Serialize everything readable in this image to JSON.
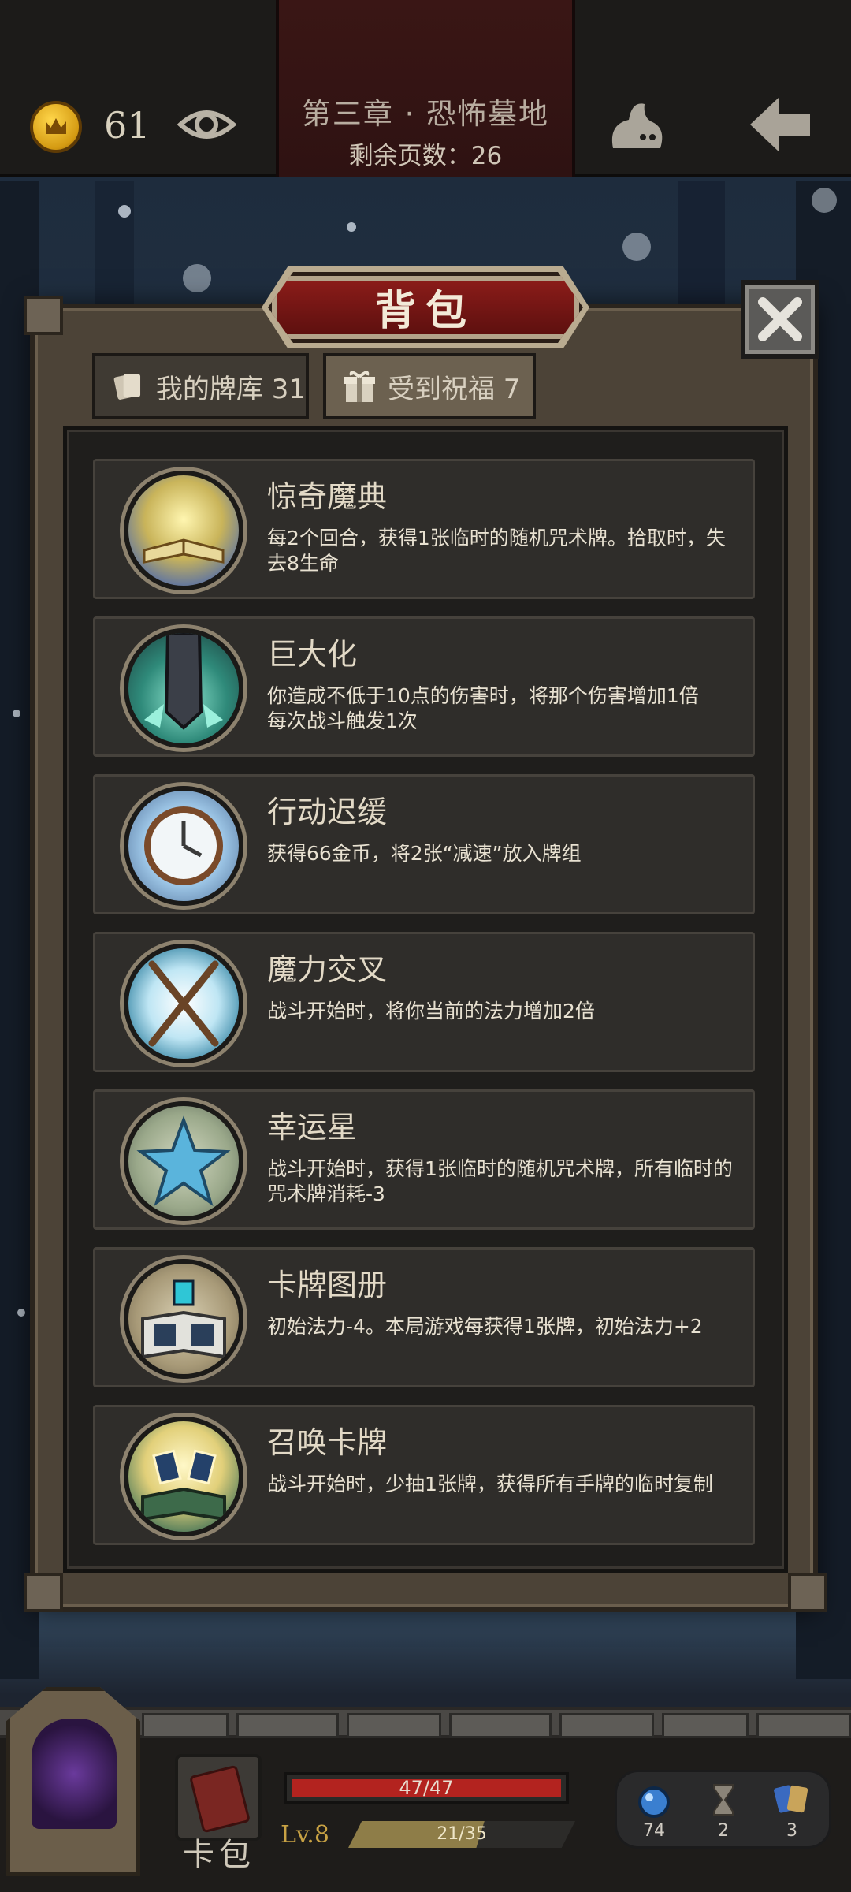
{
  "header": {
    "gold": "61",
    "chapter_title": "第三章 · 恐怖墓地",
    "pages_remaining": "剩余页数：26"
  },
  "modal": {
    "title": "背包",
    "tabs": [
      {
        "label": "我的牌库 31",
        "selected": false
      },
      {
        "label": "受到祝福 7",
        "selected": true
      }
    ],
    "blessings": [
      {
        "name": "惊奇魔典",
        "desc": "每2个回合，获得1张临时的随机咒术牌。拾取时，失去8生命",
        "icon": "open-book-icon"
      },
      {
        "name": "巨大化",
        "desc": "你造成不低于10点的伤害时，将那个伤害增加1倍\n每次战斗触发1次",
        "icon": "giant-sword-icon"
      },
      {
        "name": "行动迟缓",
        "desc": "获得66金币，将2张“减速”放入牌组",
        "icon": "frozen-clock-icon"
      },
      {
        "name": "魔力交叉",
        "desc": "战斗开始时，将你当前的法力增加2倍",
        "icon": "crossed-staffs-icon"
      },
      {
        "name": "幸运星",
        "desc": "战斗开始时，获得1张临时的随机咒术牌，所有临时的咒术牌消耗-3",
        "icon": "star-icon"
      },
      {
        "name": "卡牌图册",
        "desc": "初始法力-4。本局游戏每获得1张牌，初始法力+2",
        "icon": "card-album-icon"
      },
      {
        "name": "召唤卡牌",
        "desc": "战斗开始时，少抽1张牌，获得所有手牌的临时复制",
        "icon": "summon-cards-icon"
      }
    ]
  },
  "hud": {
    "bag_label": "卡包",
    "hp_text": "47/47",
    "hp_current": 47,
    "hp_max": 47,
    "level": "Lv.8",
    "xp_text": "21/35",
    "xp_current": 21,
    "xp_max": 35,
    "resources": [
      {
        "icon": "mana-orb-icon",
        "value": "74"
      },
      {
        "icon": "hourglass-icon",
        "value": "2"
      },
      {
        "icon": "cards-icon",
        "value": "3"
      }
    ]
  },
  "colors": {
    "banner_red": "#8e1d1a",
    "hp_red": "#b3231f",
    "xp_gold": "#8e7d48",
    "level_gold": "#c8a244"
  }
}
